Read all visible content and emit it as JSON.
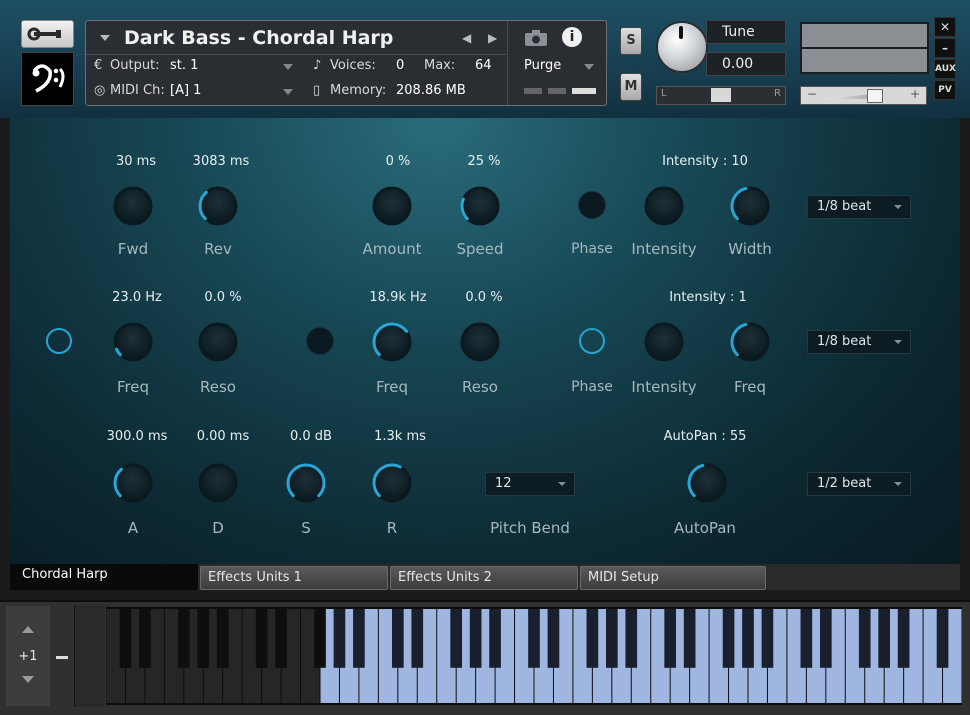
{
  "header": {
    "instrument_name": "Dark Bass - Chordal Harp",
    "output_label": "Output:",
    "output_value": "st. 1",
    "voices_label": "Voices:",
    "voices_value": "0",
    "max_label": "Max:",
    "max_value": "64",
    "midi_label": "MIDI Ch:",
    "midi_value": "[A]  1",
    "memory_label": "Memory:",
    "memory_value": "208.86 MB",
    "purge_label": "Purge",
    "solo_label": "S",
    "mute_label": "M",
    "tune_label": "Tune",
    "tune_value": "0.00",
    "pan_left": "L",
    "pan_right": "R",
    "vol_minus": "−",
    "vol_plus": "+",
    "aux_label": "AUX",
    "pv_label": "PV"
  },
  "row1": {
    "fwd_value": "30 ms",
    "fwd_label": "Fwd",
    "fwd_level": 0.0,
    "rev_value": "3083 ms",
    "rev_label": "Rev",
    "rev_level": 0.35,
    "amount_value": "0 %",
    "amount_label": "Amount",
    "amount_level": 0.0,
    "speed_value": "25 %",
    "speed_label": "Speed",
    "speed_level": 0.25,
    "phase_label": "Phase",
    "intensity_header": "Intensity : 10",
    "intensity_label": "Intensity",
    "intensity_level": 0.0,
    "width_label": "Width",
    "width_level": 0.45,
    "beat_value": "1/8 beat"
  },
  "row2": {
    "freq1_value": "23.0 Hz",
    "freq1_label": "Freq",
    "freq1_level": 0.08,
    "reso1_value": "0.0 %",
    "reso1_label": "Reso",
    "reso1_level": 0.0,
    "freq2_value": "18.9k Hz",
    "freq2_label": "Freq",
    "freq2_level": 0.7,
    "reso2_value": "0.0 %",
    "reso2_label": "Reso",
    "reso2_level": 0.0,
    "phase_label": "Phase",
    "intensity_header": "Intensity : 1",
    "intensity_label": "Intensity",
    "intensity_level": 0.0,
    "freq3_label": "Freq",
    "freq3_level": 0.45,
    "beat_value": "1/8 beat"
  },
  "row3": {
    "a_value": "300.0 ms",
    "a_label": "A",
    "a_level": 0.35,
    "d_value": "0.00 ms",
    "d_label": "D",
    "d_level": 0.0,
    "s_value": "0.0 dB",
    "s_label": "S",
    "s_level": 1.0,
    "r_value": "1.3k ms",
    "r_label": "R",
    "r_level": 0.6,
    "pitch_bend_value": "12",
    "pitch_bend_label": "Pitch Bend",
    "autopan_header": "AutoPan : 55",
    "autopan_label": "AutoPan",
    "autopan_level": 0.45,
    "beat_value": "1/2 beat"
  },
  "tabs": [
    "Chordal Harp",
    "Effects Units 1",
    "Effects Units 2",
    "MIDI Setup"
  ],
  "keyboard": {
    "octave_value": "+1",
    "active_range_start_key": 11
  },
  "colors": {
    "accent": "#2aa6d6",
    "active_keys": "#9fb6e0"
  }
}
